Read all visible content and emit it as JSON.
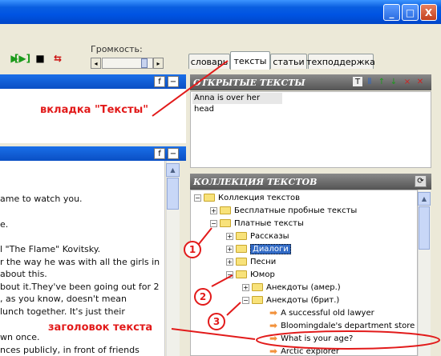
{
  "window": {
    "minimize_label": "_",
    "maximize_label": "□",
    "close_label": "X"
  },
  "toolbar": {
    "volume_label": "Громкость:"
  },
  "tabs": [
    {
      "label": "словарь"
    },
    {
      "label": "тексты"
    },
    {
      "label": "статьи"
    },
    {
      "label": "техподдержка"
    }
  ],
  "left_panel": {
    "f_label": "f",
    "minus_label": "−",
    "story_lines": [
      "ame to watch you.",
      "e.",
      "l \"The Flame\" Kovitsky.",
      "r the way he was with all the girls in",
      "about this.",
      "bout it.They've been going out for 2",
      ", as you know, doesn't mean",
      "lunch together. It's just their",
      "wn once.",
      "nces publicly, in front of friends"
    ]
  },
  "open_texts": {
    "header": "ОТКРЫТЫЕ ТЕКСТЫ",
    "tool_icons": [
      "T",
      "⫴",
      "↑",
      "↓",
      "×",
      "✕"
    ],
    "items": [
      "Anna is over her head"
    ]
  },
  "collection": {
    "header": "КОЛЛЕКЦИЯ ТЕКСТОВ",
    "tree": [
      {
        "label": "Коллекция текстов"
      },
      {
        "label": "Бесплатные пробные тексты"
      },
      {
        "label": "Платные тексты"
      },
      {
        "label": "Рассказы"
      },
      {
        "label": "Диалоги"
      },
      {
        "label": "Песни"
      },
      {
        "label": "Юмор"
      },
      {
        "label": "Анекдоты (амер.)"
      },
      {
        "label": "Анекдоты (брит.)"
      },
      {
        "label": "A successful old lawyer"
      },
      {
        "label": "Bloomingdale's department store"
      },
      {
        "label": "What is your age?"
      },
      {
        "label": "Arctic explorer"
      }
    ]
  },
  "annotations": {
    "tab_callout": "вкладка \"Тексты\"",
    "title_callout": "заголовок текста",
    "numbers": [
      "1",
      "2",
      "3"
    ]
  },
  "colors": {
    "annotation_red": "#e21a1a",
    "title_blue": "#0054e3",
    "selection_blue": "#316ac5"
  }
}
